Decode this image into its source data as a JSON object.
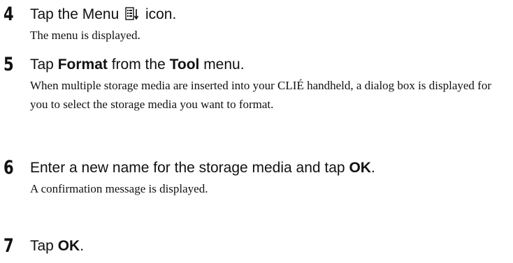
{
  "steps": [
    {
      "number": "4",
      "instruction_before_icon": "Tap the Menu",
      "icon": "menu-icon",
      "instruction_after_icon": "icon.",
      "result": "The menu is displayed."
    },
    {
      "number": "5",
      "parts": [
        "Tap ",
        "Format",
        " from the ",
        "Tool",
        " menu."
      ],
      "result": "When multiple storage media are inserted into your CLIÉ handheld, a dialog box is displayed for you to select the storage media you want to format."
    },
    {
      "number": "6",
      "parts": [
        "Enter a new name for the storage media and tap ",
        "OK",
        "."
      ],
      "result": "A confirmation message is displayed."
    },
    {
      "number": "7",
      "parts": [
        "Tap ",
        "OK",
        "."
      ]
    }
  ]
}
